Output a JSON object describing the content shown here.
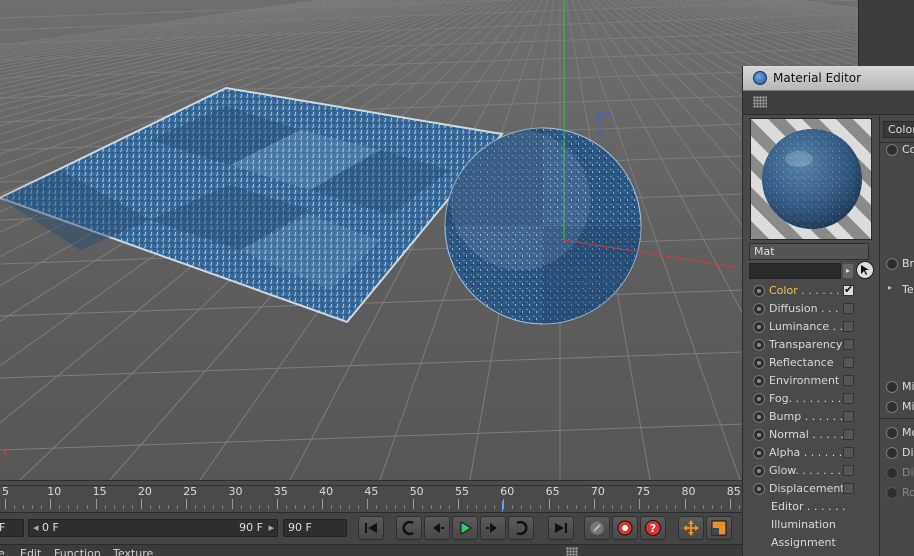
{
  "app": {
    "material_editor_title": "Material Editor"
  },
  "timeline": {
    "ticks": [
      "5",
      "10",
      "15",
      "20",
      "25",
      "30",
      "35",
      "40",
      "45",
      "50",
      "55",
      "60",
      "65",
      "70",
      "75",
      "80",
      "85"
    ],
    "current_frame_hint": "60"
  },
  "transport": {
    "start_field_left": "F",
    "range_field_start": "0 F",
    "range_field_end": "90 F",
    "end_field": "90 F"
  },
  "menubar": {
    "items": [
      "e",
      "Edit",
      "Function",
      "Texture"
    ]
  },
  "material": {
    "name": "Mat",
    "channels": [
      {
        "label": "Color . . . . . .",
        "enabled": true,
        "active": true
      },
      {
        "label": "Diffusion . . .",
        "enabled": false
      },
      {
        "label": "Luminance . .",
        "enabled": false
      },
      {
        "label": "Transparency",
        "enabled": false
      },
      {
        "label": "Reflectance",
        "enabled": false
      },
      {
        "label": "Environment",
        "enabled": false
      },
      {
        "label": "Fog. . . . . . . .",
        "enabled": false
      },
      {
        "label": "Bump . . . . . . .",
        "enabled": false
      },
      {
        "label": "Normal . . . . .",
        "enabled": false
      },
      {
        "label": "Alpha . . . . . .",
        "enabled": false
      },
      {
        "label": "Glow. . . . . . .",
        "enabled": false
      },
      {
        "label": "Displacement",
        "enabled": false
      }
    ],
    "extra_rows": [
      "Editor . . . . . .",
      "Illumination",
      "Assignment"
    ]
  },
  "attributes": {
    "tab": "Color",
    "rows": {
      "color": "Co",
      "brightness": "Br",
      "texture": "Te",
      "mix1": "Mi",
      "mix2": "Mi",
      "model": "Mo",
      "diffuse": "Di",
      "diffuse2": "Di",
      "roughness": "Ro"
    }
  },
  "colors": {
    "accent_active_channel": "#f2c14e",
    "axis_green": "#3fbf3f",
    "axis_red": "#d23a3a",
    "axis_blue": "#3c5ae0",
    "material_blue": "#3c6f9c"
  }
}
